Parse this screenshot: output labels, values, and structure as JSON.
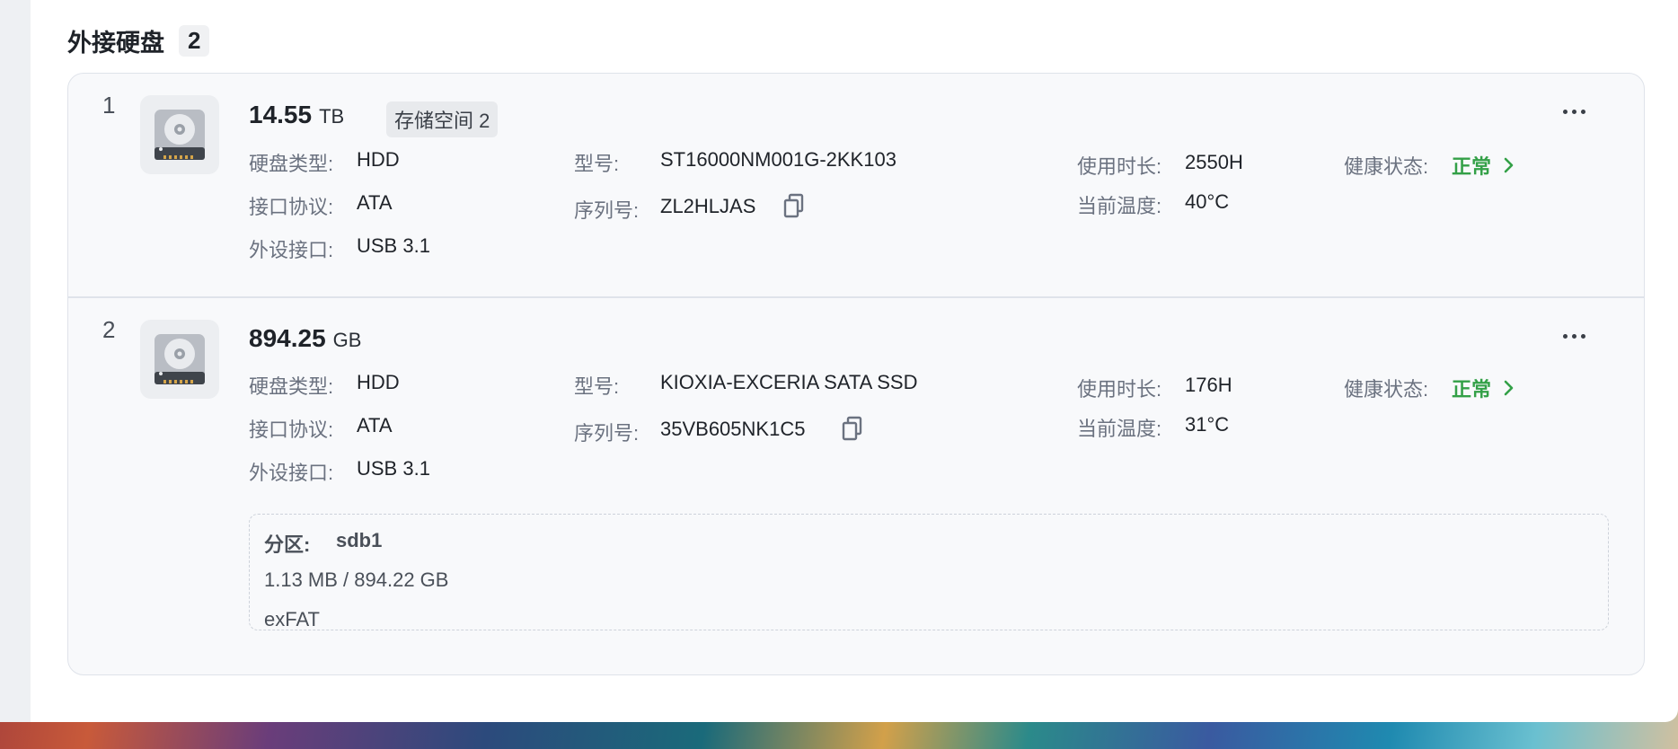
{
  "section": {
    "title": "外接硬盘",
    "count": "2"
  },
  "disks": [
    {
      "index": "1",
      "capacity": "14.55",
      "unit": "TB",
      "tag": "存储空间 2",
      "type_label": "硬盘类型:",
      "type": "HDD",
      "protocol_label": "接口协议:",
      "protocol": "ATA",
      "port_label": "外设接口:",
      "port": "USB 3.1",
      "model_label": "型号:",
      "model": "ST16000NM001G-2KK103",
      "serial_label": "序列号:",
      "serial": "ZL2HLJAS",
      "hours_label": "使用时长:",
      "hours": "2550H",
      "temp_label": "当前温度:",
      "temp": "40°C",
      "health_label": "健康状态:",
      "health": "正常"
    },
    {
      "index": "2",
      "capacity": "894.25",
      "unit": "GB",
      "type_label": "硬盘类型:",
      "type": "HDD",
      "protocol_label": "接口协议:",
      "protocol": "ATA",
      "port_label": "外设接口:",
      "port": "USB 3.1",
      "model_label": "型号:",
      "model": "KIOXIA-EXCERIA SATA SSD",
      "serial_label": "序列号:",
      "serial": "35VB605NK1C5",
      "hours_label": "使用时长:",
      "hours": "176H",
      "temp_label": "当前温度:",
      "temp": "31°C",
      "health_label": "健康状态:",
      "health": "正常",
      "partition": {
        "label": "分区:",
        "name": "sdb1",
        "usage": "1.13 MB / 894.22 GB",
        "filesystem": "exFAT"
      }
    }
  ],
  "colors": {
    "health_ok": "#33a047",
    "label": "#6b7280",
    "border": "#dfe3ea"
  },
  "icons": {
    "disk": "hard-drive-icon",
    "copy": "copy-icon",
    "more": "more-dots-icon",
    "chevron": "chevron-right-icon"
  }
}
